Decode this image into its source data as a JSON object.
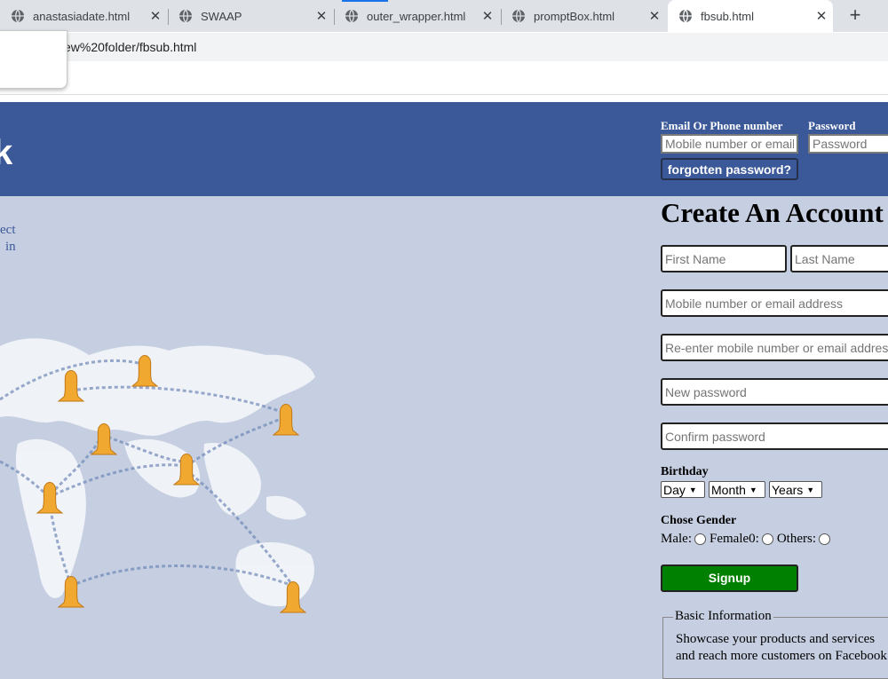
{
  "browser": {
    "tabs": [
      {
        "title": "anastasiadate.html"
      },
      {
        "title": "SWAAP"
      },
      {
        "title": "outer_wrapper.html"
      },
      {
        "title": "promptBox.html"
      },
      {
        "title": "fbsub.html"
      }
    ],
    "close_glyph": "✕",
    "new_tab_glyph": "+",
    "url": "ew%20folder/fbsub.html"
  },
  "header": {
    "email_label": "Email Or Phone number",
    "password_label": "Password",
    "email_placeholder": "Mobile number or email",
    "password_placeholder": "Password",
    "forgot_label": "forgotten password?",
    "logo_fragment": "k"
  },
  "left": {
    "line1": "ect",
    "line2": "in"
  },
  "signup": {
    "title": "Create An Account",
    "first_name_placeholder": "First Name",
    "last_name_placeholder": "Last Name",
    "contact_placeholder": "Mobile number or email address",
    "reenter_placeholder": "Re-enter mobile number or email address",
    "new_password_placeholder": "New password",
    "confirm_password_placeholder": "Confirm password",
    "birthday_label": "Birthday",
    "day_value": "Day",
    "month_value": "Month",
    "years_value": "Years",
    "gender_label": "Chose Gender",
    "male_label": "Male:",
    "female_label": "Female0:",
    "others_label": "Others:",
    "signup_label": "Signup"
  },
  "info": {
    "legend": "Basic Information",
    "line1": "Showcase your products and services",
    "line2": "and reach more customers on Facebook"
  },
  "colors": {
    "header_blue": "#3b5998",
    "page_bg": "#c6cfe1",
    "signup_green": "#008000",
    "pin_orange": "#f0a830"
  }
}
